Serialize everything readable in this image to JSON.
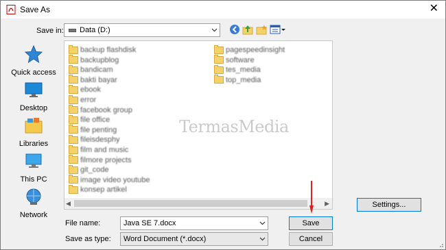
{
  "window": {
    "title": "Save As"
  },
  "toolbar": {
    "save_in_label": "Save in:",
    "save_in_value": "Data (D:)"
  },
  "places": [
    {
      "label": "Quick access",
      "icon": "star-icon"
    },
    {
      "label": "Desktop",
      "icon": "desktop-icon"
    },
    {
      "label": "Libraries",
      "icon": "libraries-icon"
    },
    {
      "label": "This PC",
      "icon": "computer-icon"
    },
    {
      "label": "Network",
      "icon": "network-icon"
    }
  ],
  "folders_col1": [
    "backup flashdisk",
    "backupblog",
    "bandicam",
    "bakti bayar",
    "ebook",
    "error",
    "facebook group",
    "file office",
    "file penting",
    "fileisdesphy",
    "film and music",
    "filmore projects",
    "git_code",
    "image video youtube",
    "konsep artikel"
  ],
  "folders_col2": [
    "pagespeedinsight",
    "software",
    "tes_media",
    "top_media"
  ],
  "watermark": "TermasMedia",
  "file_name": {
    "label": "File name:",
    "value": "Java SE 7.docx"
  },
  "save_as_type": {
    "label": "Save as type:",
    "value": "Word Document (*.docx)"
  },
  "buttons": {
    "save": "Save",
    "cancel": "Cancel",
    "settings": "Settings..."
  },
  "colors": {
    "accent": "#0078d7",
    "folder": "#f5d16a",
    "arrow": "#e02020"
  }
}
